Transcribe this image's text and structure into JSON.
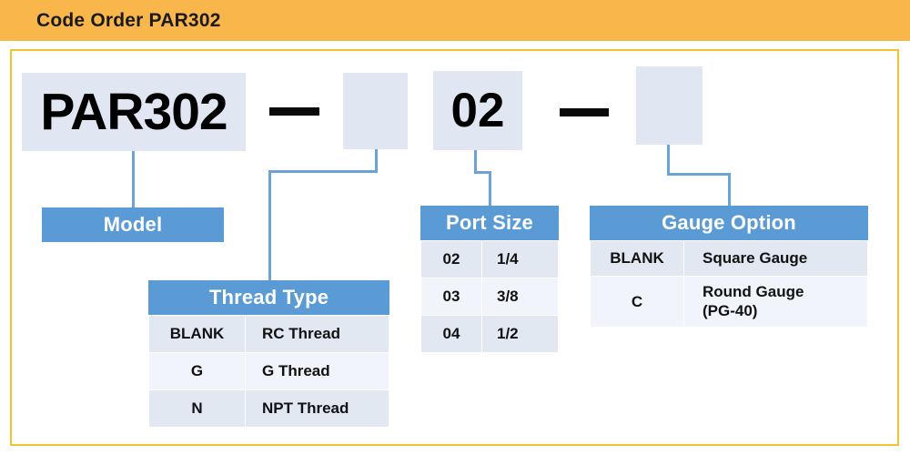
{
  "header": {
    "title": "Code Order PAR302"
  },
  "code_string": {
    "model_code": "PAR302",
    "separator_1": "—",
    "thread_code": "",
    "port_code": "02",
    "separator_2": "—",
    "gauge_code": ""
  },
  "groups": {
    "model": {
      "header": "Model",
      "rows": []
    },
    "thread": {
      "header": "Thread Type",
      "columns": [
        "code",
        "description"
      ],
      "rows": [
        {
          "code": "BLANK",
          "description": "RC Thread"
        },
        {
          "code": "G",
          "description": "G Thread"
        },
        {
          "code": "N",
          "description": "NPT Thread"
        }
      ]
    },
    "port": {
      "header": "Port Size",
      "columns": [
        "code",
        "description"
      ],
      "rows": [
        {
          "code": "02",
          "description": "1/4"
        },
        {
          "code": "03",
          "description": "3/8"
        },
        {
          "code": "04",
          "description": "1/2"
        }
      ]
    },
    "gauge": {
      "header": "Gauge Option",
      "columns": [
        "code",
        "description"
      ],
      "rows": [
        {
          "code": "BLANK",
          "description": "Square Gauge"
        },
        {
          "code": "C",
          "description": "Round Gauge\n(PG-40)"
        }
      ]
    }
  },
  "colors": {
    "header_bg": "#f9b64b",
    "frame_border": "#f2c230",
    "group_header_bg": "#5b9bd5",
    "code_box_bg": "#e1e7f2",
    "connector": "#6ba3d6",
    "row_bg": "#e2e8f2",
    "row_alt_bg": "#f1f4fa"
  }
}
